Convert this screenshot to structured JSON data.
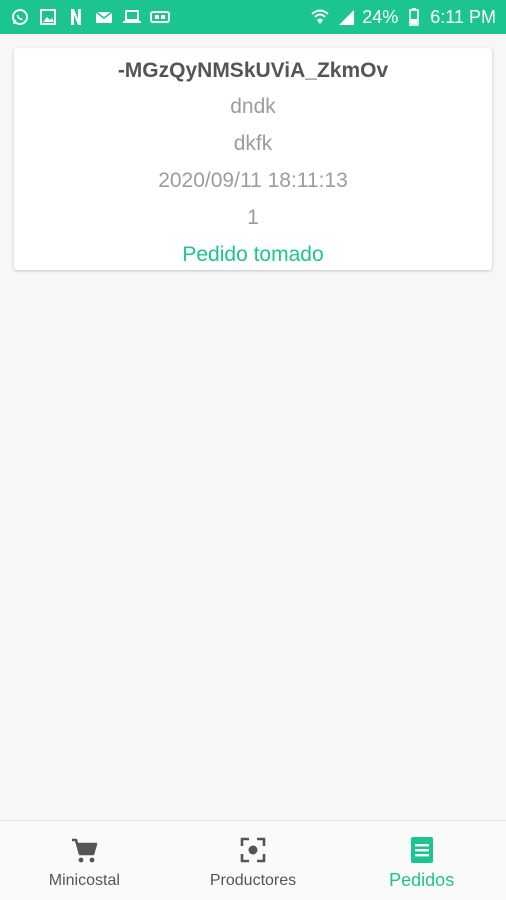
{
  "status_bar": {
    "left_icons": [
      "whatsapp-icon",
      "image-icon",
      "netflix-icon",
      "mail-icon",
      "laptop-icon",
      "gamepad-icon"
    ],
    "battery": "24%",
    "time": "6:11 PM"
  },
  "order": {
    "id": "-MGzQyNMSkUViA_ZkmOv",
    "line1": "dndk",
    "line2": "dkfk",
    "date": "2020/09/11 18:11:13",
    "quantity": "1",
    "status": "Pedido tomado"
  },
  "nav": {
    "items": [
      {
        "label": "Minicostal",
        "icon": "cart-icon"
      },
      {
        "label": "Productores",
        "icon": "focus-icon"
      },
      {
        "label": "Pedidos",
        "icon": "list-icon"
      }
    ],
    "active_index": 2
  },
  "colors": {
    "accent": "#1cc58f",
    "background": "#f7f7f7"
  }
}
